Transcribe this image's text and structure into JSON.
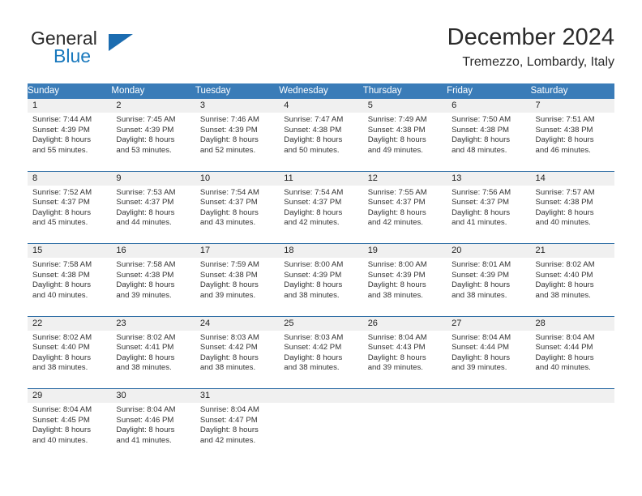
{
  "brand": {
    "name_part1": "General",
    "name_part2": "Blue",
    "accent_color": "#1878bd",
    "triangle_color": "#1b6cb0"
  },
  "header": {
    "title": "December 2024",
    "subtitle": "Tremezzo, Lombardy, Italy"
  },
  "theme": {
    "header_row_bg": "#3a7cb8",
    "daynum_row_bg": "#f0f0f0",
    "separator_color": "#2f6ea5"
  },
  "weekday_headers": [
    "Sunday",
    "Monday",
    "Tuesday",
    "Wednesday",
    "Thursday",
    "Friday",
    "Saturday"
  ],
  "weeks": [
    {
      "days": [
        {
          "num": "1",
          "sunrise": "Sunrise: 7:44 AM",
          "sunset": "Sunset: 4:39 PM",
          "daylight1": "Daylight: 8 hours",
          "daylight2": "and 55 minutes."
        },
        {
          "num": "2",
          "sunrise": "Sunrise: 7:45 AM",
          "sunset": "Sunset: 4:39 PM",
          "daylight1": "Daylight: 8 hours",
          "daylight2": "and 53 minutes."
        },
        {
          "num": "3",
          "sunrise": "Sunrise: 7:46 AM",
          "sunset": "Sunset: 4:39 PM",
          "daylight1": "Daylight: 8 hours",
          "daylight2": "and 52 minutes."
        },
        {
          "num": "4",
          "sunrise": "Sunrise: 7:47 AM",
          "sunset": "Sunset: 4:38 PM",
          "daylight1": "Daylight: 8 hours",
          "daylight2": "and 50 minutes."
        },
        {
          "num": "5",
          "sunrise": "Sunrise: 7:49 AM",
          "sunset": "Sunset: 4:38 PM",
          "daylight1": "Daylight: 8 hours",
          "daylight2": "and 49 minutes."
        },
        {
          "num": "6",
          "sunrise": "Sunrise: 7:50 AM",
          "sunset": "Sunset: 4:38 PM",
          "daylight1": "Daylight: 8 hours",
          "daylight2": "and 48 minutes."
        },
        {
          "num": "7",
          "sunrise": "Sunrise: 7:51 AM",
          "sunset": "Sunset: 4:38 PM",
          "daylight1": "Daylight: 8 hours",
          "daylight2": "and 46 minutes."
        }
      ]
    },
    {
      "days": [
        {
          "num": "8",
          "sunrise": "Sunrise: 7:52 AM",
          "sunset": "Sunset: 4:37 PM",
          "daylight1": "Daylight: 8 hours",
          "daylight2": "and 45 minutes."
        },
        {
          "num": "9",
          "sunrise": "Sunrise: 7:53 AM",
          "sunset": "Sunset: 4:37 PM",
          "daylight1": "Daylight: 8 hours",
          "daylight2": "and 44 minutes."
        },
        {
          "num": "10",
          "sunrise": "Sunrise: 7:54 AM",
          "sunset": "Sunset: 4:37 PM",
          "daylight1": "Daylight: 8 hours",
          "daylight2": "and 43 minutes."
        },
        {
          "num": "11",
          "sunrise": "Sunrise: 7:54 AM",
          "sunset": "Sunset: 4:37 PM",
          "daylight1": "Daylight: 8 hours",
          "daylight2": "and 42 minutes."
        },
        {
          "num": "12",
          "sunrise": "Sunrise: 7:55 AM",
          "sunset": "Sunset: 4:37 PM",
          "daylight1": "Daylight: 8 hours",
          "daylight2": "and 42 minutes."
        },
        {
          "num": "13",
          "sunrise": "Sunrise: 7:56 AM",
          "sunset": "Sunset: 4:37 PM",
          "daylight1": "Daylight: 8 hours",
          "daylight2": "and 41 minutes."
        },
        {
          "num": "14",
          "sunrise": "Sunrise: 7:57 AM",
          "sunset": "Sunset: 4:38 PM",
          "daylight1": "Daylight: 8 hours",
          "daylight2": "and 40 minutes."
        }
      ]
    },
    {
      "days": [
        {
          "num": "15",
          "sunrise": "Sunrise: 7:58 AM",
          "sunset": "Sunset: 4:38 PM",
          "daylight1": "Daylight: 8 hours",
          "daylight2": "and 40 minutes."
        },
        {
          "num": "16",
          "sunrise": "Sunrise: 7:58 AM",
          "sunset": "Sunset: 4:38 PM",
          "daylight1": "Daylight: 8 hours",
          "daylight2": "and 39 minutes."
        },
        {
          "num": "17",
          "sunrise": "Sunrise: 7:59 AM",
          "sunset": "Sunset: 4:38 PM",
          "daylight1": "Daylight: 8 hours",
          "daylight2": "and 39 minutes."
        },
        {
          "num": "18",
          "sunrise": "Sunrise: 8:00 AM",
          "sunset": "Sunset: 4:39 PM",
          "daylight1": "Daylight: 8 hours",
          "daylight2": "and 38 minutes."
        },
        {
          "num": "19",
          "sunrise": "Sunrise: 8:00 AM",
          "sunset": "Sunset: 4:39 PM",
          "daylight1": "Daylight: 8 hours",
          "daylight2": "and 38 minutes."
        },
        {
          "num": "20",
          "sunrise": "Sunrise: 8:01 AM",
          "sunset": "Sunset: 4:39 PM",
          "daylight1": "Daylight: 8 hours",
          "daylight2": "and 38 minutes."
        },
        {
          "num": "21",
          "sunrise": "Sunrise: 8:02 AM",
          "sunset": "Sunset: 4:40 PM",
          "daylight1": "Daylight: 8 hours",
          "daylight2": "and 38 minutes."
        }
      ]
    },
    {
      "days": [
        {
          "num": "22",
          "sunrise": "Sunrise: 8:02 AM",
          "sunset": "Sunset: 4:40 PM",
          "daylight1": "Daylight: 8 hours",
          "daylight2": "and 38 minutes."
        },
        {
          "num": "23",
          "sunrise": "Sunrise: 8:02 AM",
          "sunset": "Sunset: 4:41 PM",
          "daylight1": "Daylight: 8 hours",
          "daylight2": "and 38 minutes."
        },
        {
          "num": "24",
          "sunrise": "Sunrise: 8:03 AM",
          "sunset": "Sunset: 4:42 PM",
          "daylight1": "Daylight: 8 hours",
          "daylight2": "and 38 minutes."
        },
        {
          "num": "25",
          "sunrise": "Sunrise: 8:03 AM",
          "sunset": "Sunset: 4:42 PM",
          "daylight1": "Daylight: 8 hours",
          "daylight2": "and 38 minutes."
        },
        {
          "num": "26",
          "sunrise": "Sunrise: 8:04 AM",
          "sunset": "Sunset: 4:43 PM",
          "daylight1": "Daylight: 8 hours",
          "daylight2": "and 39 minutes."
        },
        {
          "num": "27",
          "sunrise": "Sunrise: 8:04 AM",
          "sunset": "Sunset: 4:44 PM",
          "daylight1": "Daylight: 8 hours",
          "daylight2": "and 39 minutes."
        },
        {
          "num": "28",
          "sunrise": "Sunrise: 8:04 AM",
          "sunset": "Sunset: 4:44 PM",
          "daylight1": "Daylight: 8 hours",
          "daylight2": "and 40 minutes."
        }
      ]
    },
    {
      "days": [
        {
          "num": "29",
          "sunrise": "Sunrise: 8:04 AM",
          "sunset": "Sunset: 4:45 PM",
          "daylight1": "Daylight: 8 hours",
          "daylight2": "and 40 minutes."
        },
        {
          "num": "30",
          "sunrise": "Sunrise: 8:04 AM",
          "sunset": "Sunset: 4:46 PM",
          "daylight1": "Daylight: 8 hours",
          "daylight2": "and 41 minutes."
        },
        {
          "num": "31",
          "sunrise": "Sunrise: 8:04 AM",
          "sunset": "Sunset: 4:47 PM",
          "daylight1": "Daylight: 8 hours",
          "daylight2": "and 42 minutes."
        },
        {
          "num": "",
          "sunrise": "",
          "sunset": "",
          "daylight1": "",
          "daylight2": ""
        },
        {
          "num": "",
          "sunrise": "",
          "sunset": "",
          "daylight1": "",
          "daylight2": ""
        },
        {
          "num": "",
          "sunrise": "",
          "sunset": "",
          "daylight1": "",
          "daylight2": ""
        },
        {
          "num": "",
          "sunrise": "",
          "sunset": "",
          "daylight1": "",
          "daylight2": ""
        }
      ]
    }
  ]
}
